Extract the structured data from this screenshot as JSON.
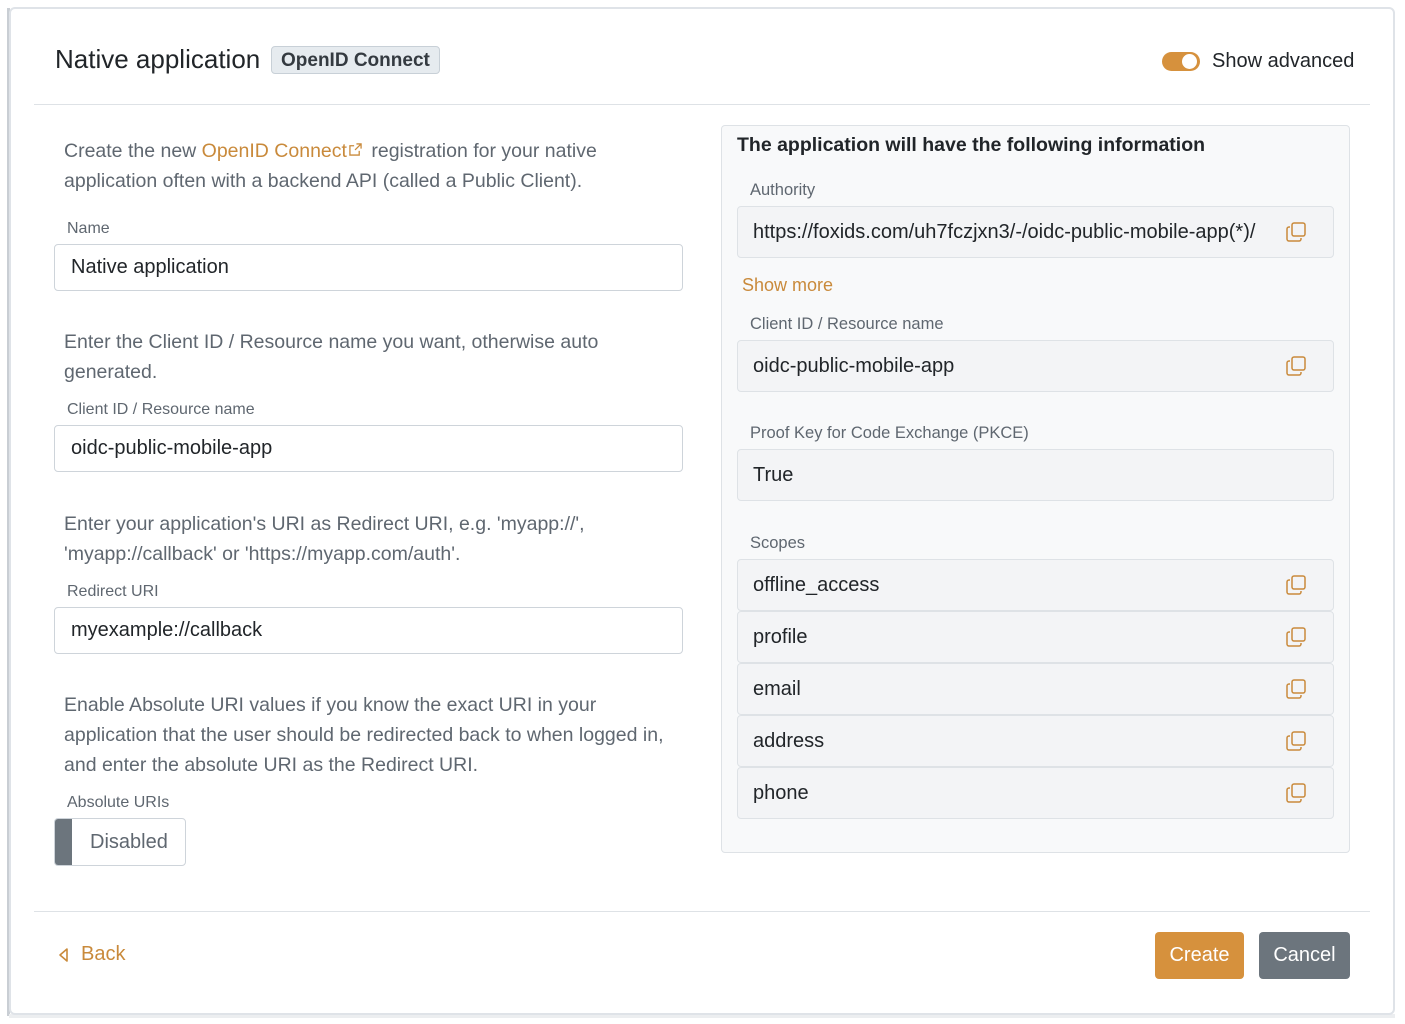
{
  "header": {
    "title": "Native application",
    "badge": "OpenID Connect",
    "toggle_label": "Show advanced"
  },
  "intro": {
    "prefix": "Create the new ",
    "link": "OpenID Connect",
    "suffix": " registration for your native application often with a backend API (called a Public Client)."
  },
  "name_field": {
    "label": "Name",
    "value": "Native application"
  },
  "client_id_help": "Enter the Client ID / Resource name you want, otherwise auto generated.",
  "client_id_field": {
    "label": "Client ID / Resource name",
    "value": "oidc-public-mobile-app"
  },
  "redirect_help": "Enter your application's URI as Redirect URI, e.g. 'myapp://', 'myapp://callback' or 'https://myapp.com/auth'.",
  "redirect_field": {
    "label": "Redirect URI",
    "value": "myexample://callback"
  },
  "absolute_help": "Enable Absolute URI values if you know the exact URI in your application that the user should be redirected back to when logged in, and enter the absolute URI as the Redirect URI.",
  "absolute_field": {
    "label": "Absolute URIs",
    "value": "Disabled"
  },
  "info_panel": {
    "title": "The application will have the following information",
    "authority_label": "Authority",
    "authority_value": "https://foxids.com/uh7fczjxn3/-/oidc-public-mobile-app(*)/",
    "show_more": "Show more",
    "client_id_label": "Client ID / Resource name",
    "client_id_value": "oidc-public-mobile-app",
    "pkce_label": "Proof Key for Code Exchange (PKCE)",
    "pkce_value": "True",
    "scopes_label": "Scopes",
    "scopes": [
      "offline_access",
      "profile",
      "email",
      "address",
      "phone"
    ]
  },
  "footer": {
    "back": "Back",
    "create": "Create",
    "cancel": "Cancel"
  },
  "colors": {
    "accent": "#d6913d",
    "link": "#c98a3b",
    "secondary": "#6c757d"
  }
}
